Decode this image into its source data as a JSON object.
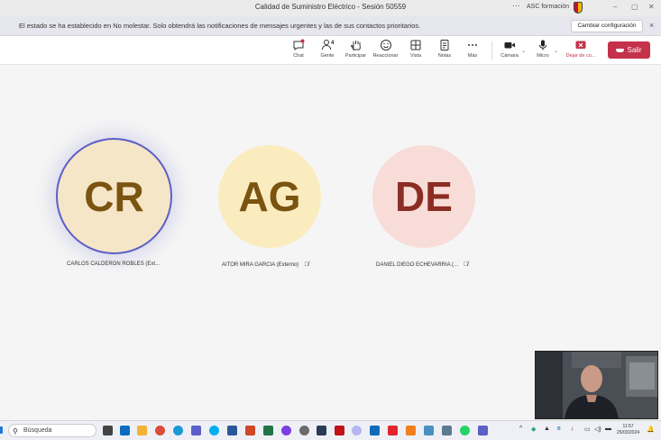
{
  "window": {
    "title": "Calidad de Suministro Eléctrico - Sesión 50559",
    "dots": "···",
    "org": "ASC formación"
  },
  "banner": {
    "message": "El estado se ha establecido en No molestar. Solo obtendrá las notificaciones de mensajes urgentes y las de sus contactos prioritarios.",
    "button": "Cambiar configuración",
    "close": "×"
  },
  "toolbar": {
    "chat": "Chat",
    "people": "Gente",
    "people_count": "4",
    "raise": "Participar",
    "react": "Reaccionar",
    "view": "Vista",
    "notes": "Notas",
    "more": "Más",
    "camera": "Cámara",
    "mic": "Micro",
    "share": "Dejar de co...",
    "leave": "Salir"
  },
  "participants": [
    {
      "initials": "CR",
      "name": "CARLOS CALDERON ROBLES (Ext...",
      "bg": "#f5e6c8",
      "fg": "#7a5410",
      "speaking": true
    },
    {
      "initials": "AG",
      "name": "AITOR MIRA GARCIA (Externo)",
      "bg": "#fbecc0",
      "fg": "#7a5410",
      "muted": true
    },
    {
      "initials": "DE",
      "name": "DANIEL DIEGO ECHEVARRIA (...",
      "bg": "#f8dcd8",
      "fg": "#8b2d22",
      "muted": true
    }
  ],
  "taskbar": {
    "search": "Búsqueda",
    "time": "11:57",
    "date": "25/03/2024"
  },
  "colors": {
    "accent": "#5b5fc7",
    "leave": "#c4314b"
  }
}
